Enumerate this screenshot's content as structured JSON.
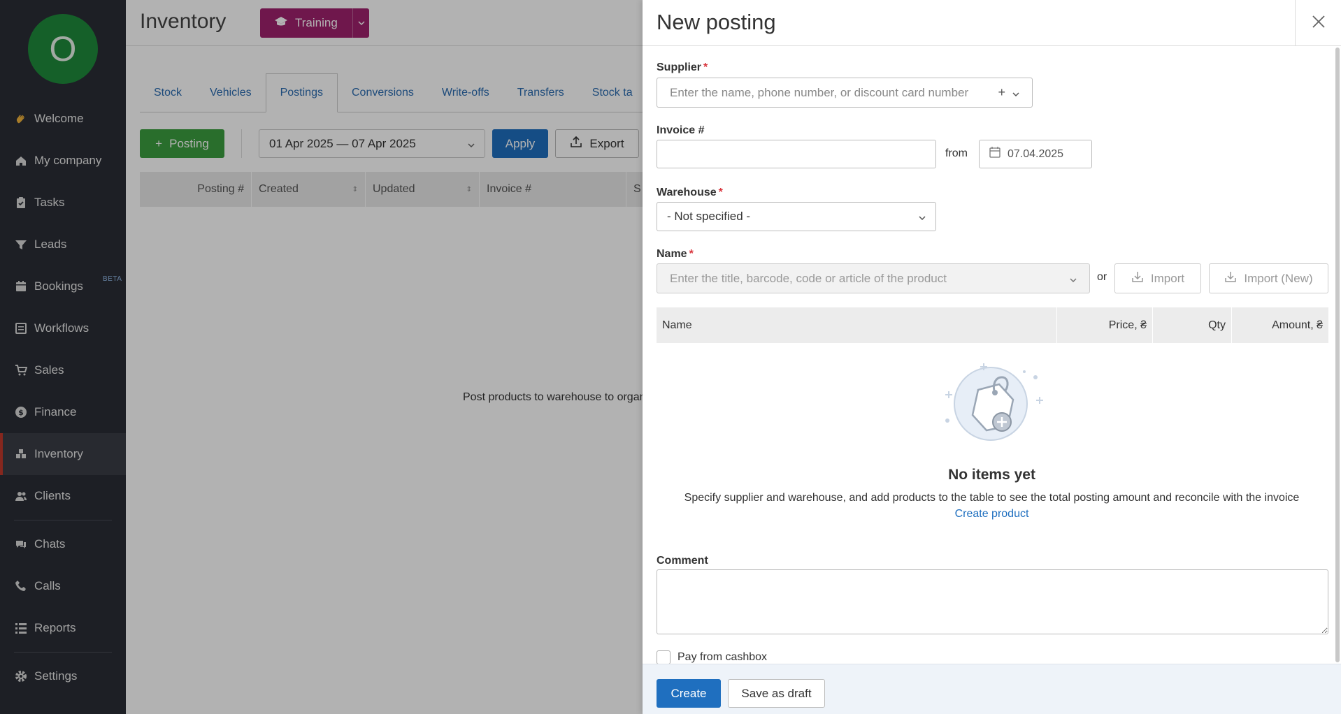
{
  "sidebar": {
    "avatar_letter": "O",
    "items": [
      {
        "label": "Welcome",
        "icon": "wave-hand-icon"
      },
      {
        "label": "My company",
        "icon": "home-icon"
      },
      {
        "label": "Tasks",
        "icon": "clipboard-icon"
      },
      {
        "label": "Leads",
        "icon": "funnel-icon"
      },
      {
        "label": "Bookings",
        "icon": "calendar-icon",
        "badge": "BETA"
      },
      {
        "label": "Workflows",
        "icon": "board-icon"
      },
      {
        "label": "Sales",
        "icon": "cart-icon"
      },
      {
        "label": "Finance",
        "icon": "dollar-icon"
      },
      {
        "label": "Inventory",
        "icon": "boxes-icon",
        "active": true
      },
      {
        "label": "Clients",
        "icon": "people-icon"
      }
    ],
    "items_bottom": [
      {
        "label": "Chats",
        "icon": "chat-icon"
      },
      {
        "label": "Calls",
        "icon": "phone-icon"
      },
      {
        "label": "Reports",
        "icon": "chart-icon"
      }
    ],
    "settings": {
      "label": "Settings",
      "icon": "gear-icon"
    }
  },
  "main": {
    "title": "Inventory",
    "training_label": "Training",
    "tabs": [
      "Stock",
      "Vehicles",
      "Postings",
      "Conversions",
      "Write-offs",
      "Transfers",
      "Stock ta"
    ],
    "active_tab": "Postings",
    "posting_button": "Posting",
    "date_range": "01 Apr 2025 — 07 Apr 2025",
    "apply_button": "Apply",
    "export_button": "Export",
    "columns": [
      "Posting #",
      "Created",
      "Updated",
      "Invoice #",
      "S"
    ],
    "empty_message": "Post products to warehouse to organ"
  },
  "drawer": {
    "title": "New posting",
    "supplier": {
      "label": "Supplier",
      "placeholder": "Enter the name, phone number, or discount card number"
    },
    "invoice": {
      "label": "Invoice #",
      "value": "",
      "from_label": "from",
      "date": "07.04.2025"
    },
    "warehouse": {
      "label": "Warehouse",
      "value": "- Not specified -"
    },
    "name": {
      "label": "Name",
      "placeholder": "Enter the title, barcode, code or article of the product",
      "or_label": "or"
    },
    "import_button": "Import",
    "import_new_button": "Import (New)",
    "items_columns": [
      "Name",
      "Price, ₴",
      "Qty",
      "Amount, ₴"
    ],
    "empty_title": "No items yet",
    "empty_text": "Specify supplier and warehouse, and add products to the table to see the total posting amount and reconcile with the invoice",
    "create_product_link": "Create product",
    "comment_label": "Comment",
    "pay_from_cashbox": "Pay from cashbox",
    "create_button": "Create",
    "save_draft_button": "Save as draft"
  },
  "colors": {
    "sidebar_bg": "#2a2d35",
    "primary": "#1f6fbf",
    "success": "#3c9e3f",
    "training": "#a0226d",
    "avatar": "#1f8a3c",
    "required": "#d9363e"
  }
}
